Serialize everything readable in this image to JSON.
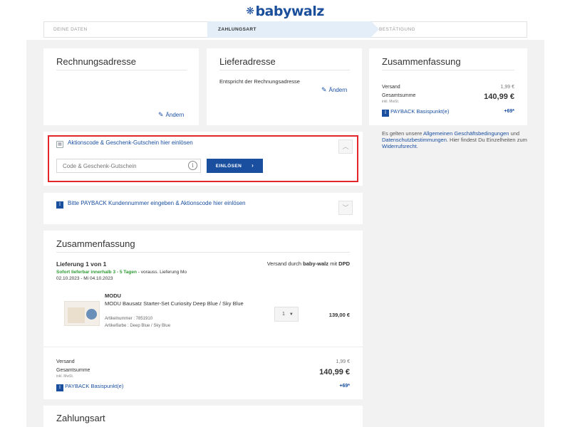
{
  "brand": {
    "logo_text": "babywalz",
    "logo_symbol": "❋"
  },
  "steps": [
    {
      "label": "DEINE DATEN",
      "state": "done"
    },
    {
      "label": "ZAHLUNGSART",
      "state": "active"
    },
    {
      "label": "BESTÄTIGUNG",
      "state": "pending"
    }
  ],
  "billing": {
    "title": "Rechnungsadresse",
    "edit_label": "Ändern"
  },
  "shipping": {
    "title": "Lieferadresse",
    "text": "Entspricht der Rechnungsadresse",
    "edit_label": "Ändern"
  },
  "voucher": {
    "link_text": "Aktionscode & Geschenk-Gutschein hier einlösen",
    "input_placeholder": "Code & Geschenk-Gutschein",
    "button_label": "EINLÖSEN"
  },
  "payback": {
    "link_text": "Bitte PAYBACK Kundennummer eingeben & Aktionscode hier einlösen"
  },
  "summary_side": {
    "title": "Zusammenfassung",
    "shipping_label": "Versand",
    "shipping_value": "1,99 €",
    "total_label": "Gesamtsumme",
    "total_value": "140,99 €",
    "vat_note": "inkl. MwSt.",
    "payback_label": "PAYBACK Basispunkt(e)",
    "payback_value": "+69*",
    "terms_pre": "Es gelten unsere ",
    "terms_link1": "Allgemeinen Geschäftsbedingungen",
    "terms_mid": " und ",
    "terms_link2": "Datenschutzbestimmungen",
    "terms_mid2": ". Hier findest Du Einzelheiten zum ",
    "terms_link3": "Widerrufsrecht",
    "terms_end": "."
  },
  "order": {
    "title": "Zusammenfassung",
    "delivery_title": "Lieferung 1 von 1",
    "shipping_by_pre": "Versand durch ",
    "shipping_by_company": "baby-walz",
    "shipping_by_mid": " mit ",
    "shipping_by_carrier": "DPD",
    "availability": "Sofort lieferbar innerhalb 3 - 5 Tagen",
    "delivery_estimate": " - vorauss. Lieferung Mo",
    "delivery_dates": "02.10.2023 - Mi 04.10.2023",
    "item": {
      "brand": "MODU",
      "name": "MODU Bausatz Starter-Set Curiosity Deep Blue / Sky Blue",
      "article_number": "Artikelnummer : 7851910",
      "color": "Artikelfarbe : Deep Blue / Sky Blue",
      "quantity": "1",
      "price": "139,00 €"
    },
    "shipping_label": "Versand",
    "shipping_value": "1,99 €",
    "total_label": "Gesamtsumme",
    "total_value": "140,99 €",
    "vat_note": "inkl. MwSt.",
    "payback_label": "PAYBACK Basispunkt(e)",
    "payback_value": "+69*"
  },
  "payment": {
    "title": "Zahlungsart"
  },
  "colors": {
    "brand_blue": "#1a4fa0",
    "highlight_red": "#e3262a",
    "availability_green": "#2e9b34",
    "step_active_bg": "#e3eef9"
  },
  "icons": [
    "calendar-icon",
    "pencil-icon",
    "info-icon",
    "chevron-up-icon",
    "chevron-down-icon",
    "chevron-right-icon",
    "payback-icon"
  ]
}
